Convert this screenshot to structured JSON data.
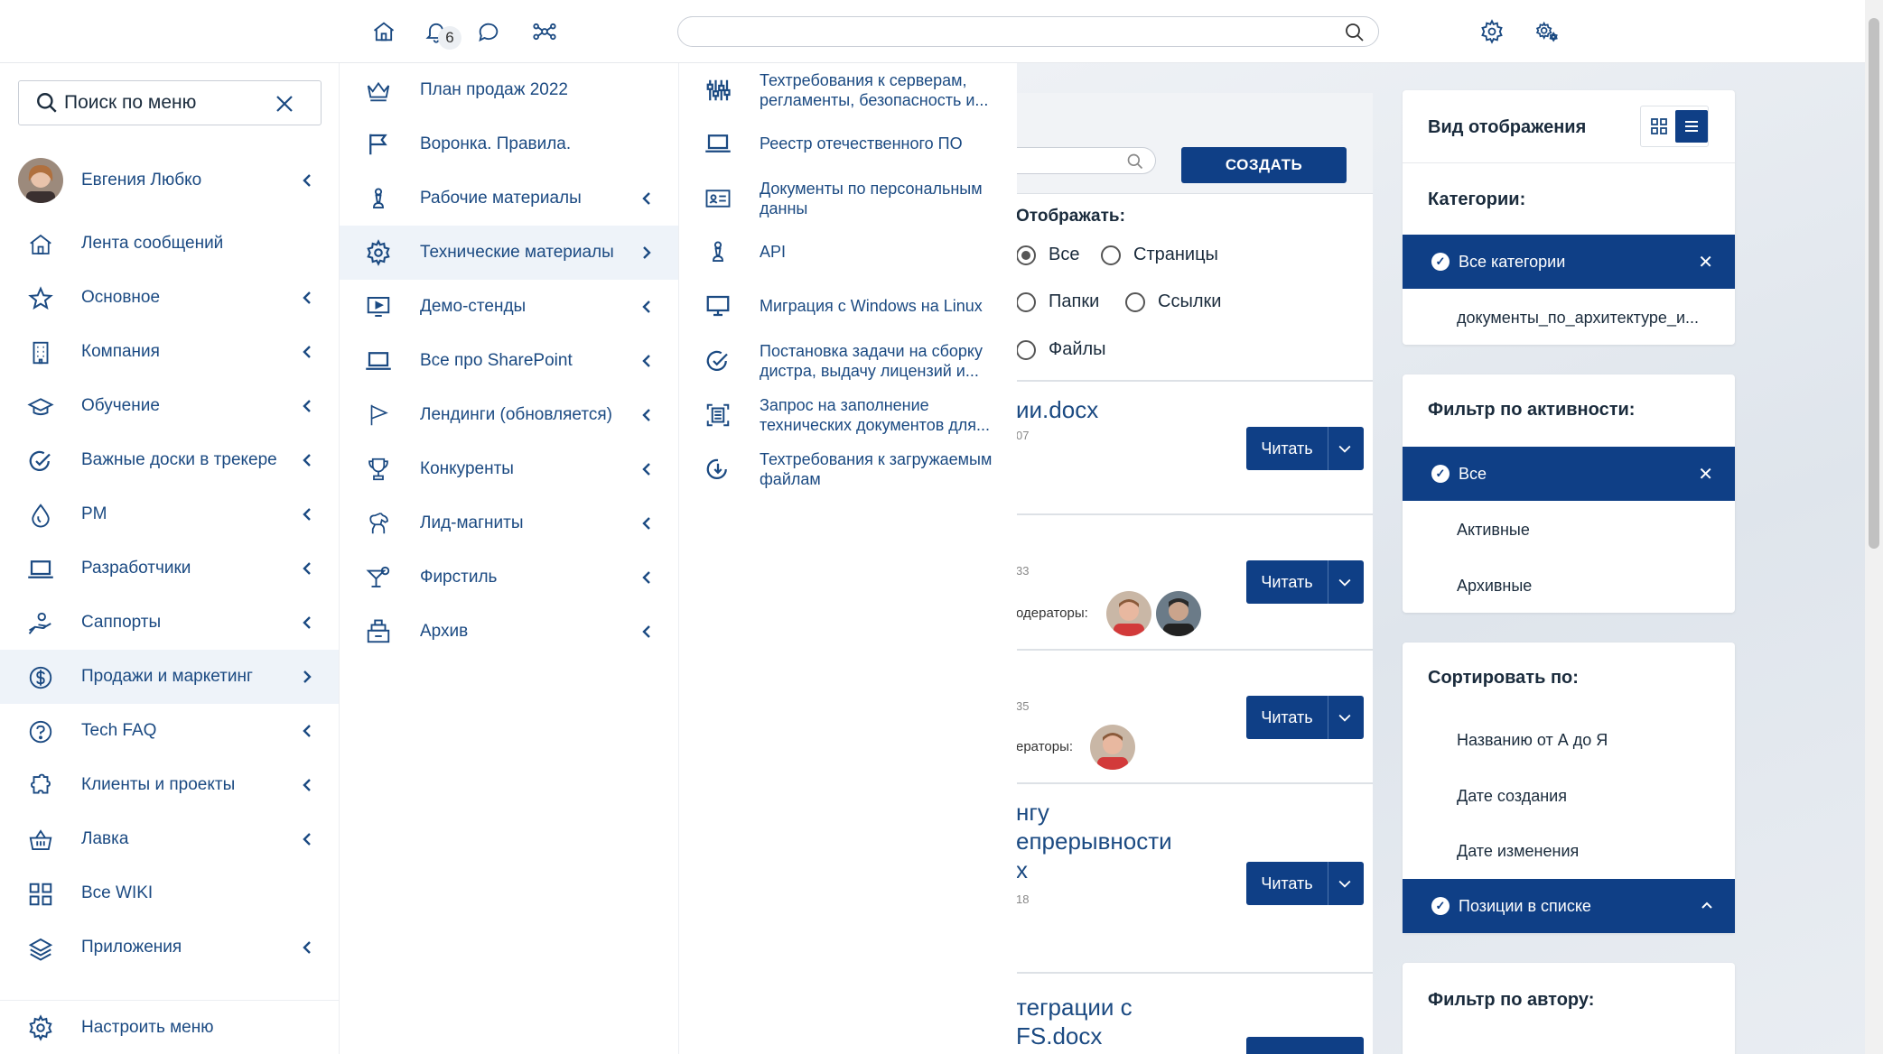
{
  "topbar": {
    "notifications_count": "6",
    "search_placeholder": ""
  },
  "left_menu": {
    "search_placeholder": "Поиск по меню",
    "user_name": "Евгения Любко",
    "items": [
      {
        "label": "Лента сообщений",
        "icon": "home-icon"
      },
      {
        "label": "Основное",
        "icon": "star-icon"
      },
      {
        "label": "Компания",
        "icon": "building-icon"
      },
      {
        "label": "Обучение",
        "icon": "graduation-cap-icon"
      },
      {
        "label": "Важные доски в трекере",
        "icon": "check-circle-icon"
      },
      {
        "label": "PM",
        "icon": "drop-icon"
      },
      {
        "label": "Разработчики",
        "icon": "laptop-icon"
      },
      {
        "label": "Саппорты",
        "icon": "hand-icon"
      },
      {
        "label": "Продажи и маркетинг",
        "icon": "dollar-circle-icon"
      },
      {
        "label": "Tech FAQ",
        "icon": "question-icon"
      },
      {
        "label": "Клиенты и проекты",
        "icon": "puzzle-icon"
      },
      {
        "label": "Лавка",
        "icon": "basket-icon"
      },
      {
        "label": "Все WIKI",
        "icon": "grid-icon"
      },
      {
        "label": "Приложения",
        "icon": "layers-icon"
      }
    ],
    "bottom_label": "Настроить меню"
  },
  "submenu": {
    "items": [
      {
        "label": "План продаж 2022",
        "icon": "crown-icon"
      },
      {
        "label": "Воронка. Правила.",
        "icon": "flag-icon"
      },
      {
        "label": "Рабочие материалы",
        "icon": "chess-pawn-icon"
      },
      {
        "label": "Техническиe материалы",
        "icon": "gear-icon"
      },
      {
        "label": "Демо-стенды",
        "icon": "play-screen-icon"
      },
      {
        "label": "Все про SharePoint",
        "icon": "laptop-icon"
      },
      {
        "label": "Лендинги (обновляется)",
        "icon": "flag-outline-icon"
      },
      {
        "label": "Конкуренты",
        "icon": "trophy-icon"
      },
      {
        "label": "Лид-магниты",
        "icon": "horse-icon"
      },
      {
        "label": "Фирстиль",
        "icon": "cocktail-icon"
      },
      {
        "label": "Архив",
        "icon": "archive-icon"
      }
    ]
  },
  "tech_menu": {
    "items": [
      {
        "label": "Техтребования к серверам, регламенты, безопасность и...",
        "icon": "sliders-icon"
      },
      {
        "label": "Реестр отечественного ПО",
        "icon": "laptop-icon"
      },
      {
        "label": "Документы по персональным данны",
        "icon": "id-card-icon"
      },
      {
        "label": "API",
        "icon": "chess-pawn-icon"
      },
      {
        "label": "Миграция с Windows на Linux",
        "icon": "monitor-icon"
      },
      {
        "label": "Постановка задачи на сборку дистра, выдачу лицензий и...",
        "icon": "check-circle-icon"
      },
      {
        "label": "Запрос на заполнение технических документов для...",
        "icon": "document-scan-icon"
      },
      {
        "label": "Техтребования к загружаемым файлам",
        "icon": "download-circle-icon"
      }
    ]
  },
  "main": {
    "create_label": "СОЗДАТЬ",
    "show_label": "Отображать:",
    "radio_options": [
      "Все",
      "Страницы",
      "Папки",
      "Ссылки",
      "Файлы"
    ],
    "read_label": "Читать",
    "docs": [
      {
        "title": "ии.docx",
        "meta": "07",
        "moderators": ""
      },
      {
        "title": "",
        "meta": "33",
        "moderators": "одераторы:"
      },
      {
        "title": "",
        "meta": "35",
        "moderators": "ераторы:"
      },
      {
        "title_lines": [
          "нгу",
          "епрерывности",
          "х"
        ],
        "meta": "18"
      },
      {
        "title_lines": [
          "теграции с",
          "FS.docx"
        ]
      }
    ]
  },
  "right_panel": {
    "view_title": "Вид отображения",
    "categories_title": "Категории:",
    "categories": [
      "Все категории",
      "документы_по_архитектуре_и..."
    ],
    "activity_title": "Фильтр по активности:",
    "activity": [
      "Все",
      "Активные",
      "Архивные"
    ],
    "sort_title": "Сортировать по:",
    "sort": [
      "Названию от А до Я",
      "Дате создания",
      "Дате изменения",
      "Позиции в списке"
    ],
    "author_title": "Фильтр по автору:"
  },
  "colors": {
    "primary": "#0f3f86",
    "link": "#1b4a82",
    "active_bg": "#eef3f9"
  }
}
